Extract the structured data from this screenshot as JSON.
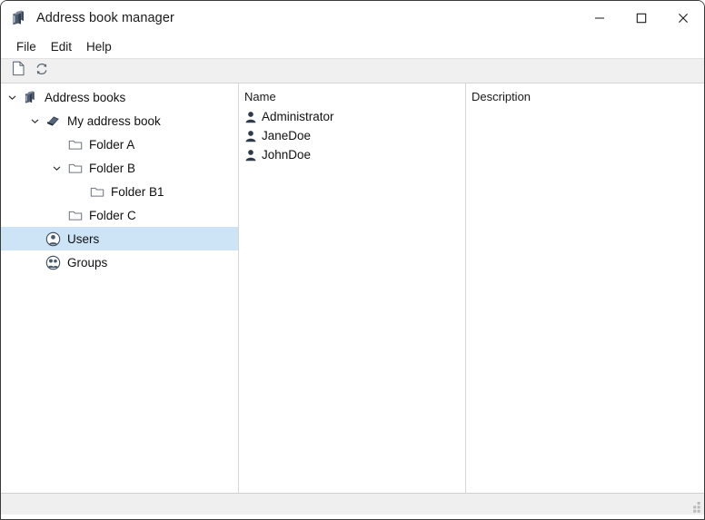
{
  "window": {
    "title": "Address book manager",
    "title_icon": "address-books-stack-icon",
    "controls": {
      "minimize": "—",
      "maximize": "□",
      "close": "✕"
    }
  },
  "menubar": {
    "items": [
      {
        "label": "File"
      },
      {
        "label": "Edit"
      },
      {
        "label": "Help"
      }
    ]
  },
  "toolbar": {
    "buttons": [
      {
        "name": "new-document-button",
        "icon": "page-icon"
      },
      {
        "name": "refresh-button",
        "icon": "refresh-icon"
      }
    ]
  },
  "tree": {
    "items": [
      {
        "label": "Address books",
        "icon": "books-stack-icon",
        "indent": 0,
        "twisty": "chevron-down",
        "selected": false
      },
      {
        "label": "My address book",
        "icon": "book-icon",
        "indent": 1,
        "twisty": "chevron-down",
        "selected": false
      },
      {
        "label": "Folder A",
        "icon": "folder-icon",
        "indent": 2,
        "twisty": "none",
        "selected": false
      },
      {
        "label": "Folder B",
        "icon": "folder-icon",
        "indent": 2,
        "twisty": "chevron-down",
        "selected": false
      },
      {
        "label": "Folder B1",
        "icon": "folder-icon",
        "indent": 3,
        "twisty": "none",
        "selected": false
      },
      {
        "label": "Folder C",
        "icon": "folder-icon",
        "indent": 2,
        "twisty": "none",
        "selected": false
      },
      {
        "label": "Users",
        "icon": "user-circle-icon",
        "indent": 1,
        "twisty": "none",
        "selected": true
      },
      {
        "label": "Groups",
        "icon": "group-circle-icon",
        "indent": 1,
        "twisty": "none",
        "selected": false
      }
    ]
  },
  "list": {
    "column_header": "Name",
    "rows": [
      {
        "name": "Administrator",
        "icon": "user-icon"
      },
      {
        "name": "JaneDoe",
        "icon": "user-icon"
      },
      {
        "name": "JohnDoe",
        "icon": "user-icon"
      }
    ]
  },
  "description_pane": {
    "column_header": "Description",
    "rows": []
  },
  "statusbar": {
    "text": "",
    "grip": "resize-grip"
  },
  "colors": {
    "selection": "#cce4f6",
    "toolbar_bg": "#f0f0f0",
    "statusbar_bg": "#efefef",
    "icon_navy": "#3c4a5e",
    "folder_outline": "#6b7280",
    "text": "#111111"
  }
}
